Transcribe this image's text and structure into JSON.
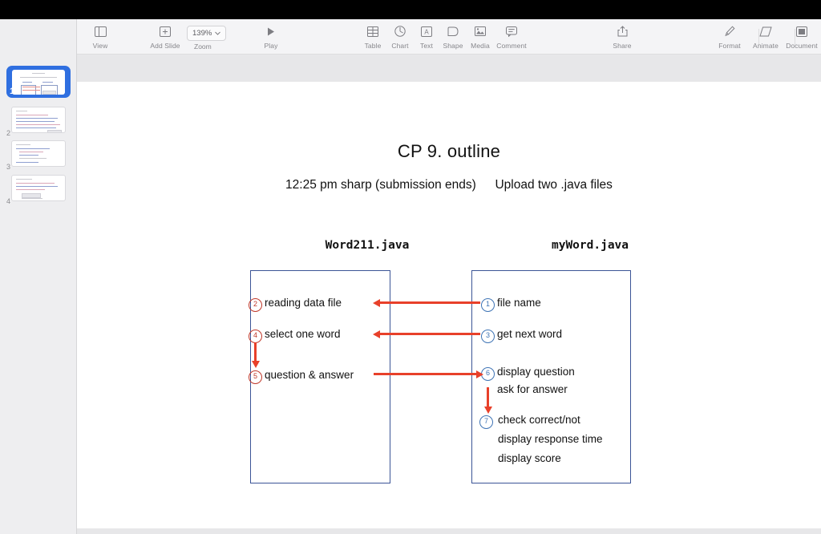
{
  "window": {
    "titlebar_color": "#000000"
  },
  "toolbar": {
    "view_label": "View",
    "view_icon": "sidebar-icon",
    "zoom_value": "139%",
    "zoom_label": "Zoom",
    "zoom_chevron_icon": "chevron-down-icon",
    "add_slide_label": "Add Slide",
    "add_slide_icon": "plus-square-icon",
    "play_label": "Play",
    "play_icon": "play-triangle-icon",
    "table_label": "Table",
    "table_icon": "table-grid-icon",
    "chart_label": "Chart",
    "chart_icon": "pie-chart-icon",
    "text_label": "Text",
    "text_icon": "text-box-icon",
    "shape_label": "Shape",
    "shape_icon": "shape-icon",
    "media_label": "Media",
    "media_icon": "image-icon",
    "comment_label": "Comment",
    "comment_icon": "speech-bubble-icon",
    "share_label": "Share",
    "share_icon": "share-arrow-icon",
    "format_label": "Format",
    "format_icon": "paintbrush-icon",
    "animate_label": "Animate",
    "animate_icon": "diamond-icon",
    "document_label": "Document",
    "document_icon": "document-icon"
  },
  "sidebar": {
    "slides": [
      {
        "number": "1",
        "selected": true
      },
      {
        "number": "2",
        "selected": false
      },
      {
        "number": "3",
        "selected": false
      },
      {
        "number": "4",
        "selected": false
      }
    ],
    "selected_color": "#2f6fe0"
  },
  "slide": {
    "title": "CP 9. outline",
    "subtitle_left": "12:25 pm sharp (submission ends)",
    "subtitle_right": "Upload two .java files",
    "left_file": "Word211.java",
    "right_file": "myWord.java",
    "left_steps": [
      {
        "num": "2",
        "text": "reading data file"
      },
      {
        "num": "4",
        "text": "select one word"
      },
      {
        "num": "5",
        "text": "question & answer"
      }
    ],
    "right_steps": [
      {
        "num": "1",
        "text": "file name",
        "cont": []
      },
      {
        "num": "3",
        "text": "get next word",
        "cont": []
      },
      {
        "num": "6",
        "text": "display question",
        "cont": [
          "ask for answer"
        ]
      },
      {
        "num": "7",
        "text": "check correct/not",
        "cont": [
          "display response time",
          "display score"
        ]
      }
    ],
    "colors": {
      "box_border": "#3b5496",
      "arrow": "#e8402a",
      "left_circle": "#c0392b",
      "right_circle": "#3f74b5"
    }
  }
}
